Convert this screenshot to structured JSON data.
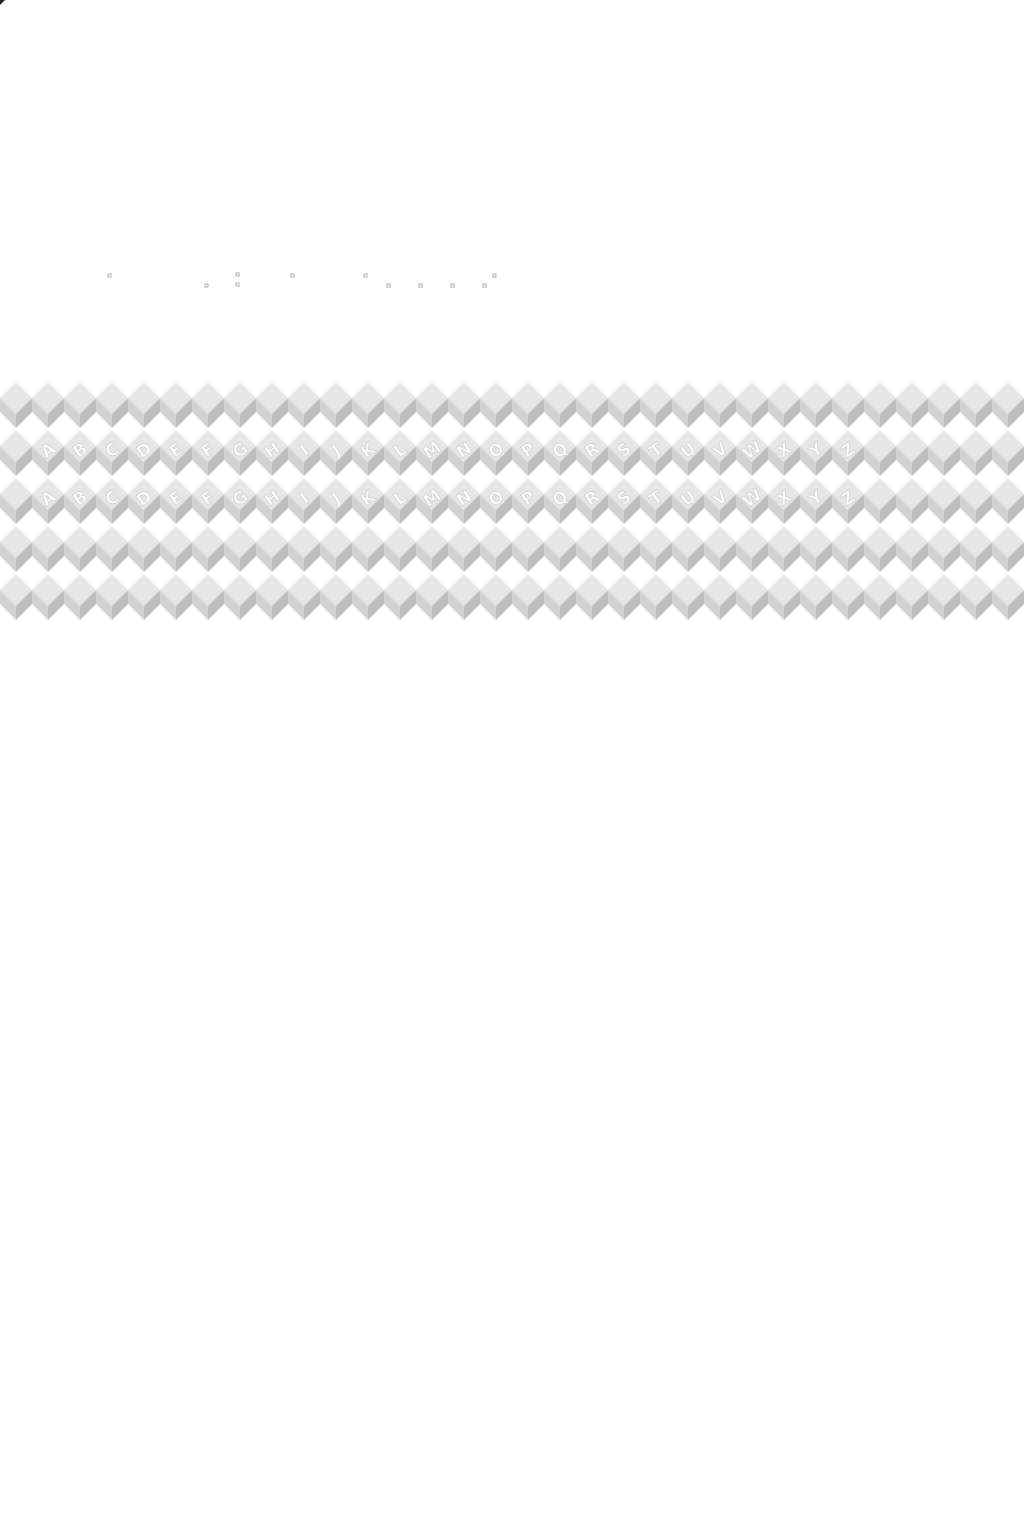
{
  "pattern": {
    "description_colors": {
      "background": "#ffffff",
      "cube_top": "#e6e6e6",
      "cube_left": "#d2d2d2",
      "cube_right": "#bdbdbd",
      "cube_edge": "#f4f4f4",
      "dot_stroke": "#9a9a9a"
    },
    "rows": 5,
    "columns": 32,
    "letter_rows": [
      [
        "A",
        "B",
        "C",
        "D",
        "E",
        "F",
        "G",
        "H",
        "I",
        "J",
        "K",
        "L",
        "M",
        "N",
        "O",
        "P",
        "Q",
        "R",
        "S",
        "T",
        "U",
        "V",
        "W",
        "X",
        "Y",
        "Z"
      ],
      [
        "A",
        "B",
        "C",
        "D",
        "E",
        "F",
        "G",
        "H",
        "I",
        "J",
        "K",
        "L",
        "M",
        "N",
        "O",
        "P",
        "Q",
        "R",
        "S",
        "T",
        "U",
        "V",
        "W",
        "X",
        "Y",
        "Z"
      ]
    ],
    "letter_row_indices": [
      1,
      2
    ],
    "letter_start_column": 1,
    "letter_orientation": "rotated"
  }
}
